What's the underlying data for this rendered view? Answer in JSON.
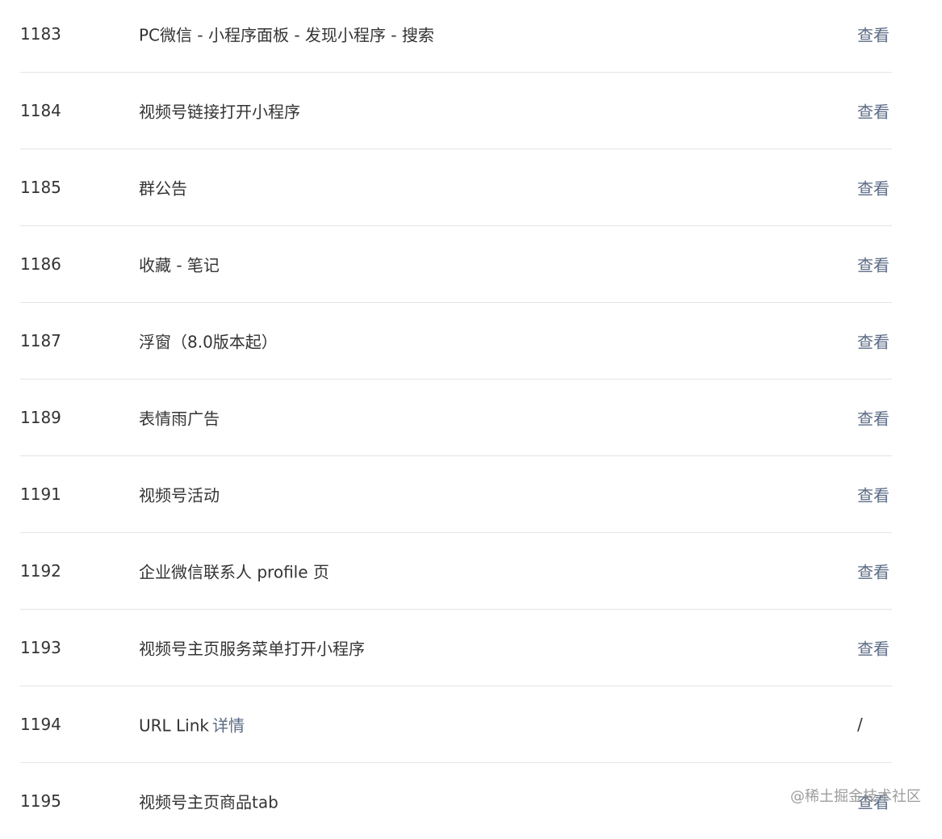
{
  "rows": [
    {
      "id": "1183",
      "name": "PC微信 - 小程序面板 - 发现小程序 - 搜索",
      "link": "",
      "action": "查看",
      "action_is_link": true
    },
    {
      "id": "1184",
      "name": "视频号链接打开小程序",
      "link": "",
      "action": "查看",
      "action_is_link": true
    },
    {
      "id": "1185",
      "name": "群公告",
      "link": "",
      "action": "查看",
      "action_is_link": true
    },
    {
      "id": "1186",
      "name": "收藏 - 笔记",
      "link": "",
      "action": "查看",
      "action_is_link": true
    },
    {
      "id": "1187",
      "name": "浮窗（8.0版本起）",
      "link": "",
      "action": "查看",
      "action_is_link": true
    },
    {
      "id": "1189",
      "name": "表情雨广告",
      "link": "",
      "action": "查看",
      "action_is_link": true
    },
    {
      "id": "1191",
      "name": "视频号活动",
      "link": "",
      "action": "查看",
      "action_is_link": true
    },
    {
      "id": "1192",
      "name": "企业微信联系人 profile 页",
      "link": "",
      "action": "查看",
      "action_is_link": true
    },
    {
      "id": "1193",
      "name": "视频号主页服务菜单打开小程序",
      "link": "",
      "action": "查看",
      "action_is_link": true
    },
    {
      "id": "1194",
      "name": "URL Link",
      "link": "详情",
      "action": "/",
      "action_is_link": false
    },
    {
      "id": "1195",
      "name": "视频号主页商品tab",
      "link": "",
      "action": "查看",
      "action_is_link": true
    }
  ],
  "watermark": "@稀土掘金技术社区"
}
